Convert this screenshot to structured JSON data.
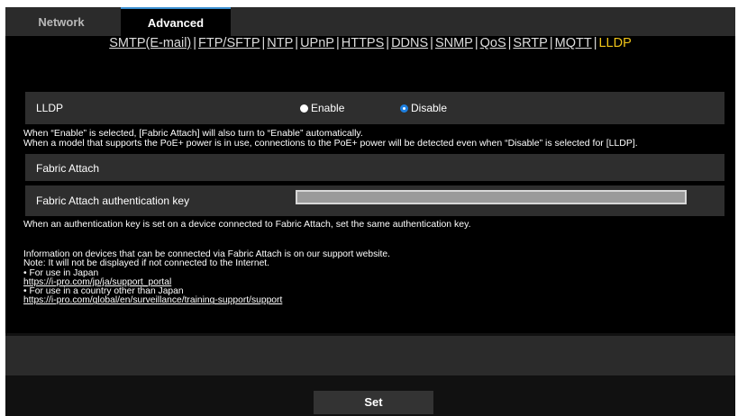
{
  "tabs": [
    {
      "label": "Network",
      "active": false
    },
    {
      "label": "Advanced",
      "active": true
    }
  ],
  "subnav": {
    "links": [
      "SMTP(E-mail)",
      "FTP/SFTP",
      "NTP",
      "UPnP",
      "HTTPS",
      "DDNS",
      "SNMP",
      "QoS",
      "SRTP",
      "MQTT"
    ],
    "separator": "|",
    "current": "LLDP"
  },
  "lldp": {
    "label": "LLDP",
    "options": [
      "Enable",
      "Disable"
    ],
    "selected": "Disable"
  },
  "notes": {
    "line1": "When “Enable” is selected, [Fabric Attach] will also turn to “Enable” automatically.",
    "line2": "When a model that supports the PoE+ power is in use, connections to the PoE+ power will be detected even when “Disable” is selected for [LLDP]."
  },
  "fabric_attach": {
    "header": "Fabric Attach",
    "key_label": "Fabric Attach authentication key",
    "key_value": "",
    "key_note": "When an authentication key is set on a device connected to Fabric Attach, set the same authentication key."
  },
  "info": {
    "line1": "Information on devices that can be connected via Fabric Attach is on our support website.",
    "line2": "Note: It will not be displayed if not connected to the Internet.",
    "japan_label": "• For use in Japan",
    "japan_url": "https://i-pro.com/jp/ja/support_portal",
    "other_label": "• For use in a country other than Japan",
    "other_url": "https://i-pro.com/global/en/surveillance/training-support/support"
  },
  "set_label": "Set",
  "colors": {
    "background": "#000000",
    "tabbar": "#2b2b2b",
    "panel": "#2e2e2e",
    "active_link": "#f0c419",
    "radio_selected": "#1d7fe0"
  }
}
